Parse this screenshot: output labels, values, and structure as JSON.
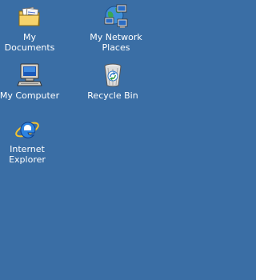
{
  "desktop": {
    "background_color": "#3a6ea5",
    "label_color": "#ffffff",
    "icons": [
      {
        "label": "My Documents",
        "icon": "folder-documents-icon"
      },
      {
        "label": "My Network\nPlaces",
        "icon": "network-places-icon"
      },
      {
        "label": "My Computer",
        "icon": "computer-icon"
      },
      {
        "label": "Recycle Bin",
        "icon": "recycle-bin-icon"
      },
      {
        "label": "Internet\nExplorer",
        "icon": "internet-explorer-icon"
      }
    ]
  }
}
